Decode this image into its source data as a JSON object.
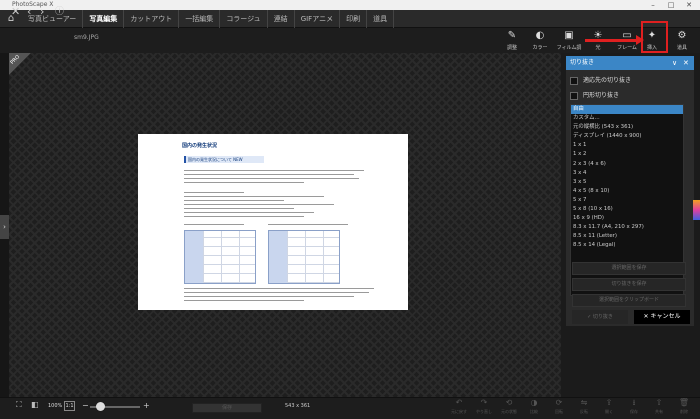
{
  "app": {
    "title": "PhotoScape X"
  },
  "menu": {
    "items": [
      {
        "label": "写真ビューアー",
        "active": false
      },
      {
        "label": "写真編集",
        "active": true
      },
      {
        "label": "カットアウト",
        "active": false
      },
      {
        "label": "一括編集",
        "active": false
      },
      {
        "label": "コラージュ",
        "active": false
      },
      {
        "label": "連結",
        "active": false
      },
      {
        "label": "GIFアニメ",
        "active": false
      },
      {
        "label": "印刷",
        "active": false
      },
      {
        "label": "道具",
        "active": false
      }
    ]
  },
  "toolbar": {
    "filename": "sm9.JPG",
    "tools": [
      {
        "icon": "edit-icon",
        "glyph": "✎",
        "label": "調整"
      },
      {
        "icon": "color-icon",
        "glyph": "◐",
        "label": "カラー"
      },
      {
        "icon": "film-icon",
        "glyph": "▣",
        "label": "フィルム調"
      },
      {
        "icon": "light-icon",
        "glyph": "☀",
        "label": "光"
      },
      {
        "icon": "frame-icon",
        "glyph": "▭",
        "label": "フレーム"
      },
      {
        "icon": "insert-icon",
        "glyph": "✦",
        "label": "挿入"
      },
      {
        "icon": "tools-icon",
        "glyph": "⚙",
        "label": "道具"
      }
    ]
  },
  "badge": {
    "pro": "PRO"
  },
  "document": {
    "heading": "国内の発生状況",
    "subheading": "国内の発生状況について NEW"
  },
  "crop_panel": {
    "title": "切り抜き",
    "options": [
      {
        "label": "適応先の切り抜き"
      },
      {
        "label": "円形切り抜き"
      }
    ],
    "list": [
      "自由",
      "カスタム...",
      "元の縦横比 (543 x 361)",
      "ディスプレイ (1440 x 900)",
      "1 x 1",
      "1 x 2",
      "2 x 3 (4 x 6)",
      "3 x 4",
      "3 x 5",
      "4 x 5 (8 x 10)",
      "5 x 7",
      "5 x 8 (10 x 16)",
      "16 x 9 (HD)",
      "8.3 x 11.7 (A4, 210 x 297)",
      "8.5 x 11 (Letter)",
      "8.5 x 14 (Legal)"
    ],
    "selected_index": 0,
    "buttons": [
      "選択範囲を保存",
      "切り抜きを保存",
      "選択範囲をクリップボード"
    ],
    "ok_label": "✓ 切り抜き",
    "cancel_label": "✕ キャンセル"
  },
  "status": {
    "zoom": "100%",
    "ratio": "1:1",
    "save_label": "保存",
    "dimensions": "543 x 361"
  },
  "bottom_tools": [
    "元に戻す",
    "やり直し",
    "元の状態",
    "比較",
    "回転",
    "反転",
    "開く",
    "保存",
    "共有",
    "削除"
  ],
  "colors": {
    "accent": "#3b86c6",
    "highlight": "#e02020"
  }
}
